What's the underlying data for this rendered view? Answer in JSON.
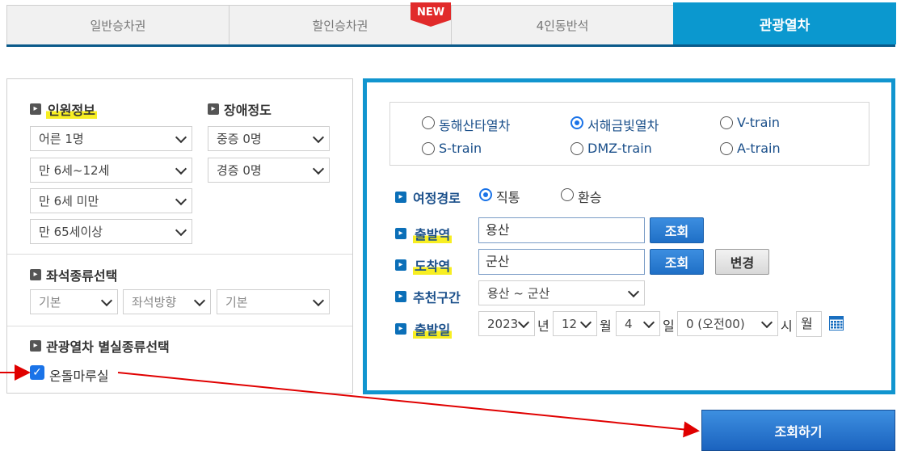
{
  "tabs": [
    {
      "label": "일반승차권",
      "active": false
    },
    {
      "label": "할인승차권",
      "active": false,
      "badge": "NEW"
    },
    {
      "label": "4인동반석",
      "active": false
    },
    {
      "label": "관광열차",
      "active": true
    }
  ],
  "passengers": {
    "title": "인원정보",
    "adult": "어른 1명",
    "child": "만 6세~12세",
    "infant": "만 6세 미만",
    "senior": "만 65세이상"
  },
  "disability": {
    "title": "장애정도",
    "severe": "중증 0명",
    "mild": "경증 0명"
  },
  "seat": {
    "title": "좌석종류선택",
    "type": "기본",
    "direction": "좌석방향",
    "position": "기본"
  },
  "special_room": {
    "title": "관광열차 별실종류선택",
    "option_label": "온돌마루실",
    "checked": true
  },
  "trains": [
    {
      "label": "동해산타열차",
      "selected": false
    },
    {
      "label": "서해금빛열차",
      "selected": true
    },
    {
      "label": "V-train",
      "selected": false
    },
    {
      "label": "S-train",
      "selected": false
    },
    {
      "label": "DMZ-train",
      "selected": false
    },
    {
      "label": "A-train",
      "selected": false
    }
  ],
  "route": {
    "label": "여정경로",
    "options": [
      {
        "label": "직통",
        "selected": true
      },
      {
        "label": "환승",
        "selected": false
      }
    ]
  },
  "departure": {
    "label": "출발역",
    "value": "용산",
    "lookup": "조회"
  },
  "arrival": {
    "label": "도착역",
    "value": "군산",
    "lookup": "조회",
    "change": "변경"
  },
  "recommended": {
    "label": "추천구간",
    "value": "용산 ~ 군산"
  },
  "date": {
    "label": "출발일",
    "year": "2023",
    "year_unit": "년",
    "month": "12",
    "month_unit": "월",
    "day": "4",
    "day_unit": "일",
    "hour": "0 (오전00)",
    "hour_unit": "시",
    "weekday": "월"
  },
  "search_button": "조회하기",
  "colors": {
    "active_tab": "#0b98cf",
    "panel_border": "#1195cf",
    "button_blue": "#1f6fc6",
    "highlight": "#f7ee22",
    "annotation_arrow": "#e00000"
  }
}
